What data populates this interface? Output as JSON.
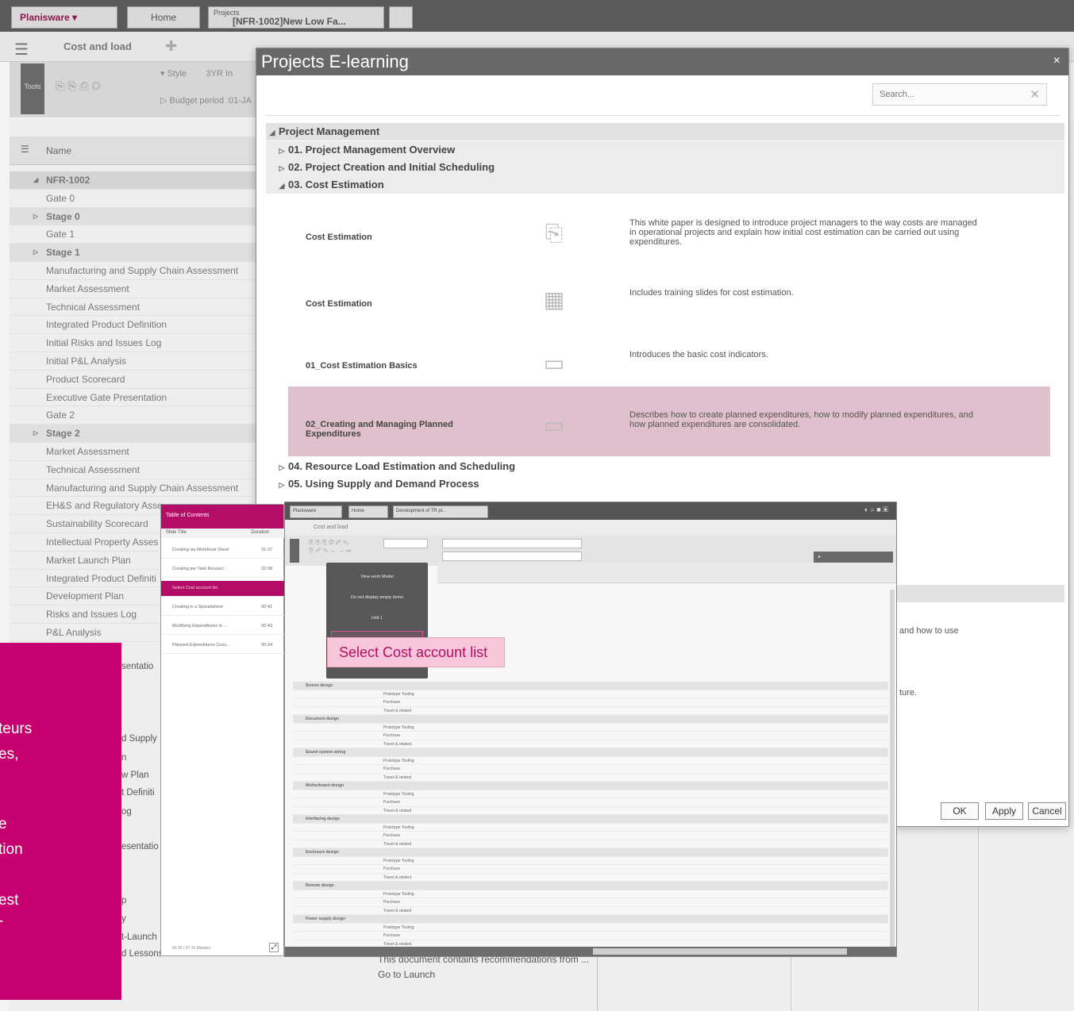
{
  "app": {
    "brand_tab": "Planisware",
    "home_tab": "Home",
    "project_tab_small": "Projects",
    "project_tab": "[NFR-1002]New Low Fa...",
    "view_title": "Cost and load",
    "style_label": "Style",
    "style_value": "3YR In",
    "budget_period": "Budget period :01-JA",
    "ribbon_label": "Tools"
  },
  "grid": {
    "name_header": "Name",
    "rows": [
      {
        "label": "NFR-1002",
        "kind": "lvl1"
      },
      {
        "label": "Gate 0",
        "kind": "item"
      },
      {
        "label": "Stage 0",
        "kind": "lvl2"
      },
      {
        "label": "Gate 1",
        "kind": "item"
      },
      {
        "label": "Stage 1",
        "kind": "lvl2"
      },
      {
        "label": "Manufacturing and Supply Chain Assessment",
        "kind": "item"
      },
      {
        "label": "Market Assessment",
        "kind": "item"
      },
      {
        "label": "Technical Assessment",
        "kind": "item"
      },
      {
        "label": "Integrated Product Definition",
        "kind": "item"
      },
      {
        "label": "Initial Risks and Issues Log",
        "kind": "item"
      },
      {
        "label": "Initial P&L Analysis",
        "kind": "item"
      },
      {
        "label": "Product Scorecard",
        "kind": "item"
      },
      {
        "label": "Executive Gate Presentation",
        "kind": "item"
      },
      {
        "label": "Gate 2",
        "kind": "item"
      },
      {
        "label": "Stage 2",
        "kind": "lvl2"
      },
      {
        "label": "Market Assessment",
        "kind": "item"
      },
      {
        "label": "Technical Assessment",
        "kind": "item"
      },
      {
        "label": "Manufacturing and Supply Chain Assessment",
        "kind": "item"
      },
      {
        "label": "EH&S and Regulatory Asse",
        "kind": "item"
      },
      {
        "label": "Sustainability Scorecard",
        "kind": "item"
      },
      {
        "label": "Intellectual Property Asses",
        "kind": "item"
      },
      {
        "label": "Market Launch Plan",
        "kind": "item"
      },
      {
        "label": "Integrated Product Definiti",
        "kind": "item"
      },
      {
        "label": "Development Plan",
        "kind": "item"
      },
      {
        "label": "Risks and Issues Log",
        "kind": "item"
      },
      {
        "label": "P&L Analysis",
        "kind": "item"
      }
    ],
    "partial_labels": [
      "sentatio",
      "d Supply",
      "n",
      "w Plan",
      "t Definiti",
      "og",
      "esentatio",
      "p",
      "y",
      "t-Launch",
      "d Lessons Learned"
    ],
    "bottom_text_1": "This document contains recommendations from ...",
    "bottom_text_2": "Go to Launch"
  },
  "dialog": {
    "title": "Projects E-learning",
    "close": "×",
    "search_placeholder": "Search...",
    "search_clear": "✕",
    "root_section": "Project Management",
    "sections": [
      {
        "label": "01. Project Management Overview",
        "arrow": "▷"
      },
      {
        "label": "02. Project Creation and Initial Scheduling",
        "arrow": "▷"
      },
      {
        "label": "03. Cost Estimation",
        "arrow": "◢"
      }
    ],
    "cards": [
      {
        "title": "Cost Estimation",
        "icon": "pdf-icon",
        "glyph": "⎘",
        "desc": "This white paper is designed to introduce project managers to the way costs are managed in operational projects and explain how initial cost estimation can be carried out using expenditures."
      },
      {
        "title": "Cost Estimation",
        "icon": "slides-icon",
        "glyph": "▦",
        "desc": "Includes training slides for cost estimation."
      },
      {
        "title": "01_Cost Estimation Basics",
        "icon": "video-icon",
        "glyph": "▭",
        "desc": "Introduces the basic cost indicators."
      },
      {
        "title": "02_Creating and Managing Planned Expenditures",
        "icon": "video-icon",
        "glyph": "▭",
        "desc": "Describes how to create planned expenditures, how to modify planned expenditures, and how planned expenditures are consolidated."
      }
    ],
    "more_sections": [
      {
        "label": "04. Resource Load Estimation and Scheduling",
        "arrow": "▷"
      },
      {
        "label": "05. Using Supply and Demand Process",
        "arrow": "▷"
      }
    ],
    "hidden_fragments": [
      "and how to use",
      "ture."
    ],
    "buttons": {
      "ok": "OK",
      "apply": "Apply",
      "cancel": "Cancel"
    }
  },
  "preview": {
    "toc_title": "Table of Contents",
    "toc_col_title": "Slide Title",
    "toc_col_duration": "Duration",
    "toc_items": [
      {
        "label": "Creating via Workbook Sheet",
        "dur": "01:37"
      },
      {
        "label": "Creating per Task Resourc",
        "dur": "02:08"
      },
      {
        "label": "Select Cost account list",
        "dur": "",
        "active": true
      },
      {
        "label": "Creating in a Spreadsheet",
        "dur": "00:41"
      },
      {
        "label": "Modifying Expenditures in ...",
        "dur": "00:43"
      },
      {
        "label": "Planned Expenditures Cons...",
        "dur": "00:34"
      }
    ],
    "toc_footer": "00:35 / 07:10 Minutes",
    "inner_tab": "Development of TR pl...",
    "inner_view": "Cost and load",
    "popup_items": [
      "View work Model",
      "Do not display empty items",
      "Unit 1",
      "Cost account list"
    ],
    "callout": "Select Cost account list",
    "groups": [
      "Screen design",
      "Document design",
      "Sound system wiring",
      "Motherboard design",
      "Interfacing design",
      "Enclosure design",
      "Remote design",
      "Power supply design"
    ],
    "subrows": [
      "Prototype Tooling",
      "Purchase",
      "Travel & related"
    ]
  },
  "panel": {
    "lines": [
      "teurs",
      "es,",
      "e",
      "tion",
      "est",
      "-"
    ]
  },
  "colors": {
    "accent": "#c6006f",
    "selected_card": "#dfc0cc",
    "header": "#686868"
  }
}
